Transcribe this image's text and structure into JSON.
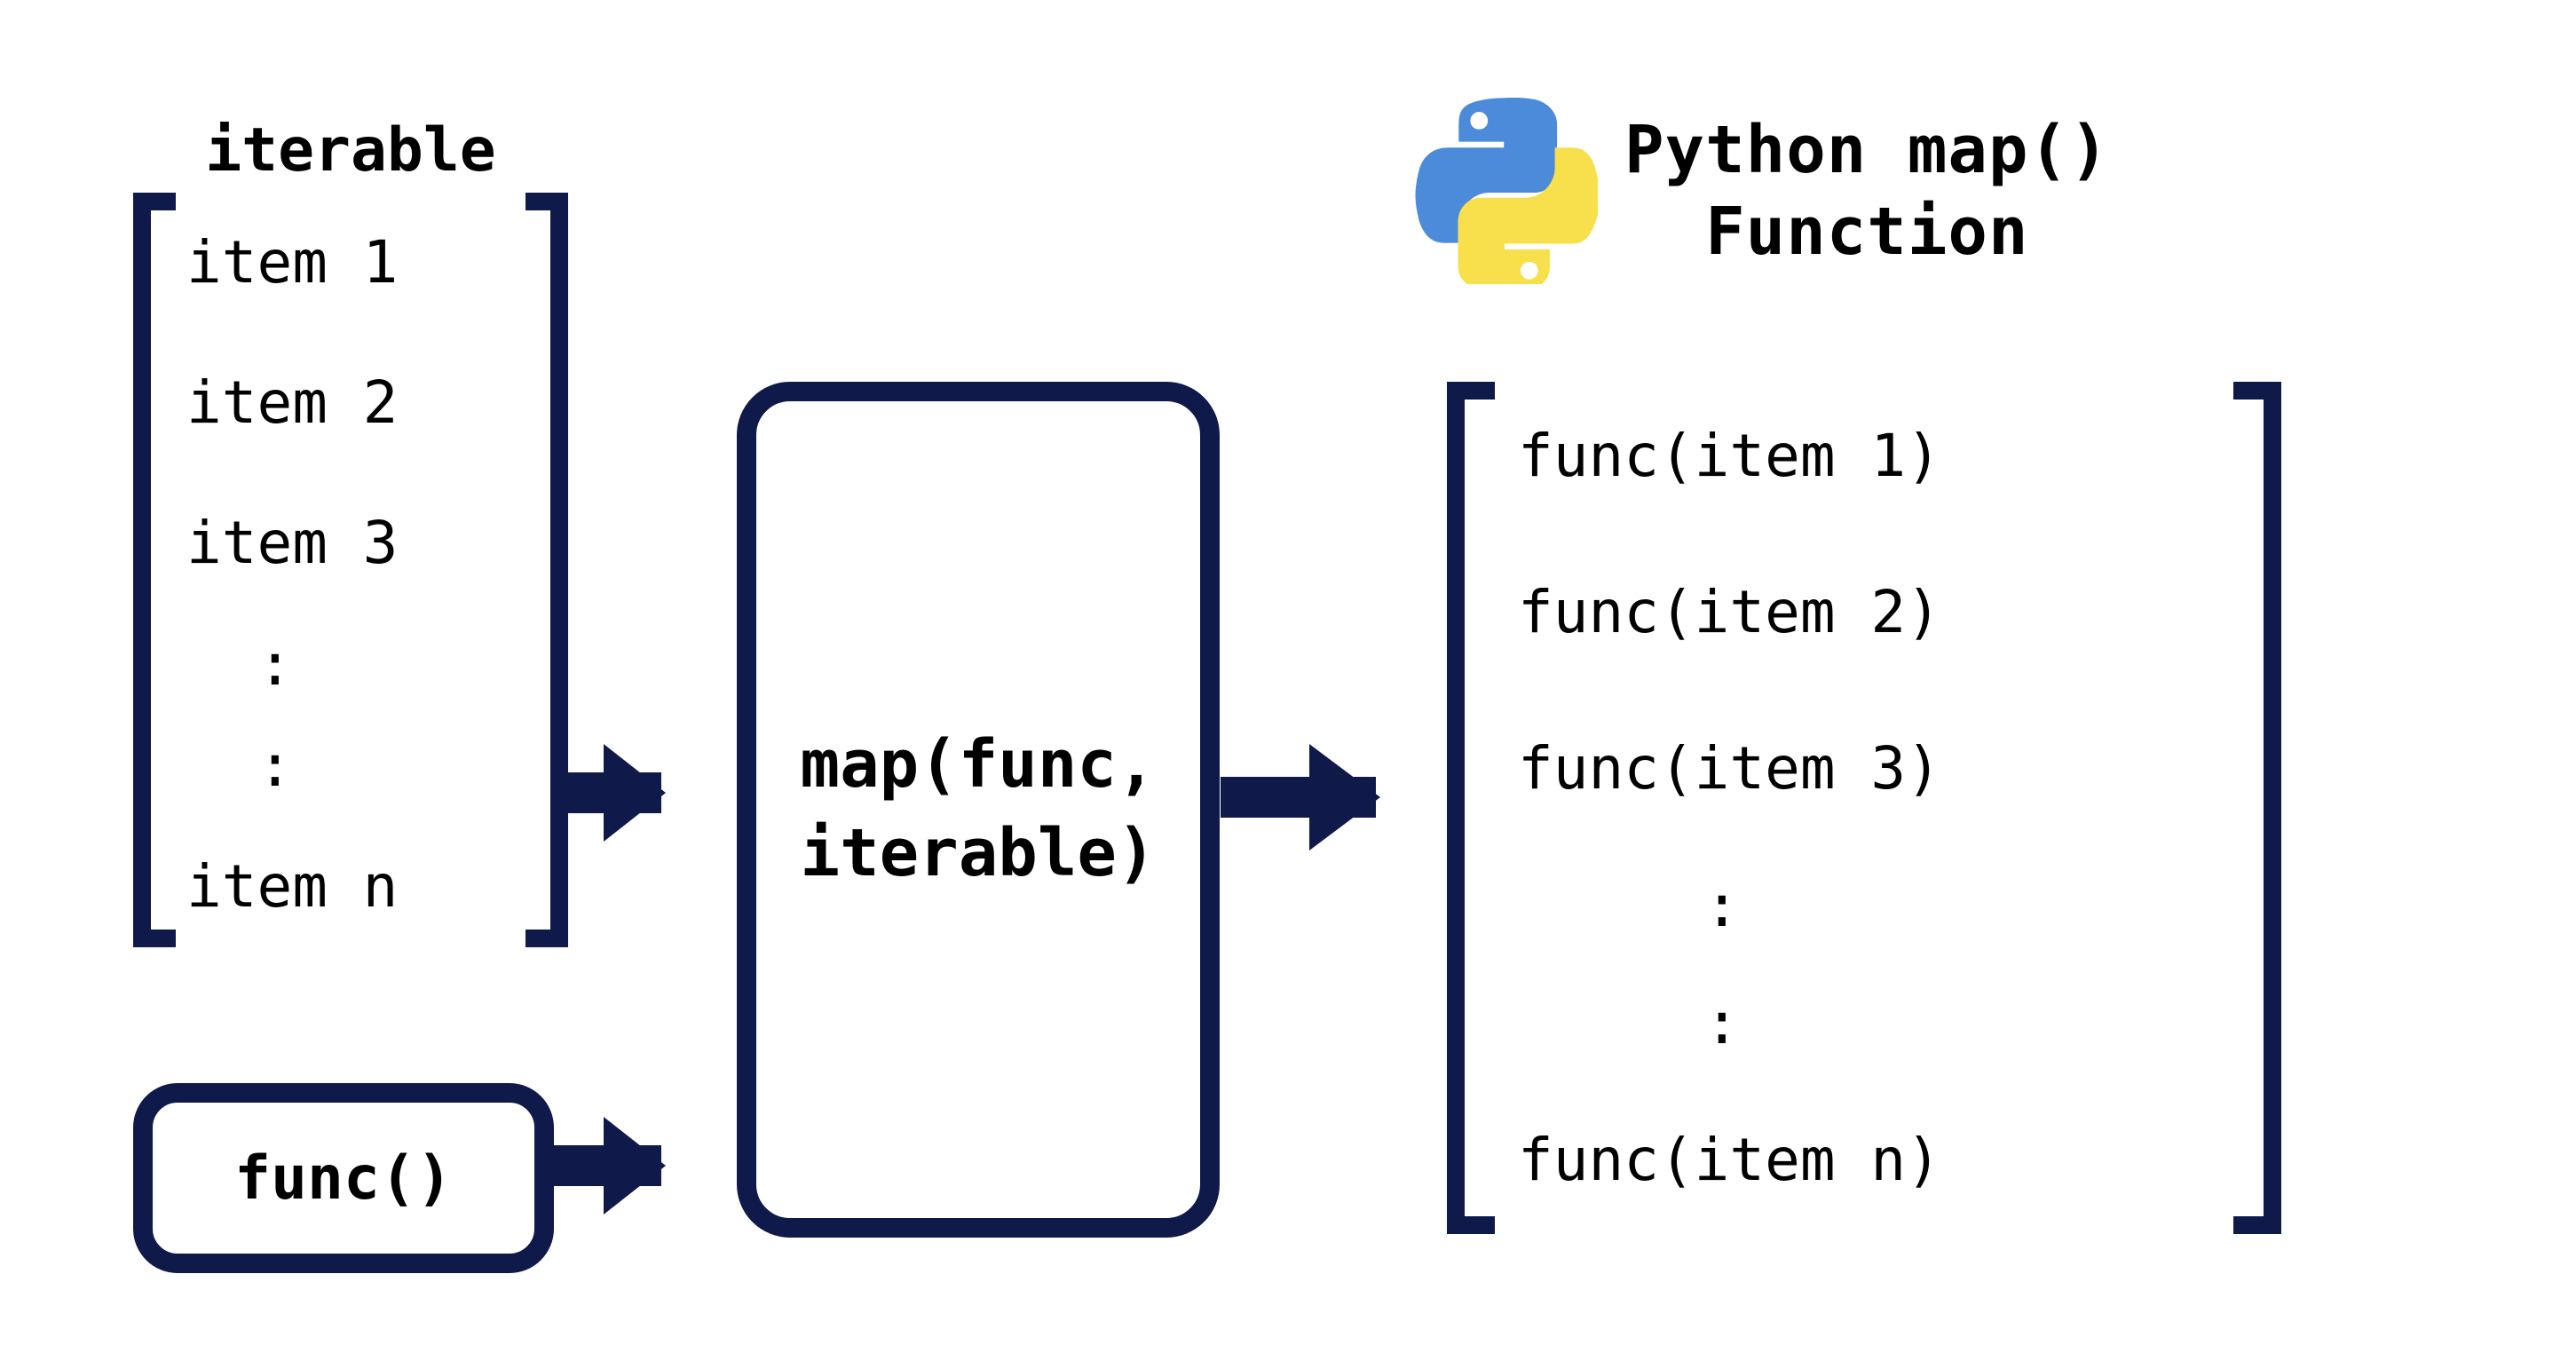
{
  "title": {
    "line1": "Python map()",
    "line2": "Function"
  },
  "colors": {
    "stroke": "#0f1a4a",
    "python_blue": "#4B8BDA",
    "python_yellow": "#F7E04B"
  },
  "iterable": {
    "label": "iterable",
    "items": [
      "item 1",
      "item 2",
      "item 3",
      ":",
      ":",
      "item n"
    ]
  },
  "func_box": {
    "label": "func()"
  },
  "map_box": {
    "line1": "map(func,",
    "line2": "iterable)"
  },
  "output": {
    "items": [
      "func(item 1)",
      "func(item 2)",
      "func(item 3)",
      ":",
      ":",
      "func(item n)"
    ]
  }
}
